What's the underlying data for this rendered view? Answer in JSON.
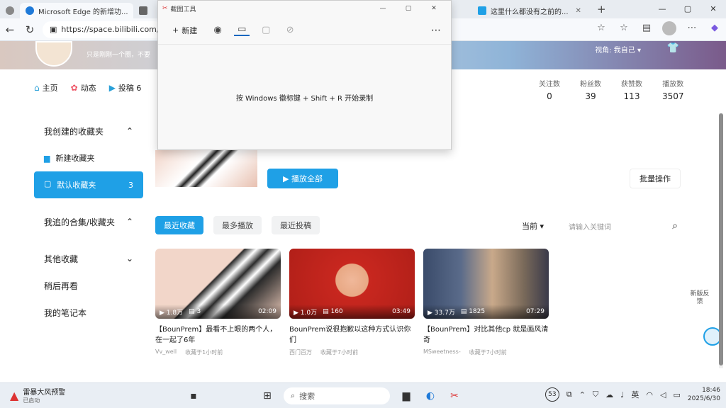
{
  "browser": {
    "tabs": [
      {
        "label": "Microsoft Edge 的新增功..."
      },
      {
        "label": ""
      },
      {
        "label": "这里什么都没有之前的..."
      }
    ],
    "url": "https://space.bilibili.com/3",
    "controls": {
      "minimize": "—",
      "maximize": "▢",
      "close": "✕"
    }
  },
  "banner": {
    "signature": "只是刚刚一个圈，不要",
    "view_label": "视角: 我自己 ▾"
  },
  "profile_nav": [
    {
      "label": "主页",
      "icon": "home-icon"
    },
    {
      "label": "动态",
      "icon": "dynamic-icon"
    },
    {
      "label": "投稿 6",
      "icon": "upload-icon"
    }
  ],
  "stats": [
    {
      "label": "关注数",
      "value": "0"
    },
    {
      "label": "粉丝数",
      "value": "39"
    },
    {
      "label": "获赞数",
      "value": "113"
    },
    {
      "label": "播放数",
      "value": "3507"
    }
  ],
  "sidebar": {
    "created_header": "我创建的收藏夹",
    "new_folder": "新建收藏夹",
    "default_folder": "默认收藏夹",
    "default_count": "3",
    "followed_header": "我追的合集/收藏夹",
    "other": "其他收藏",
    "watch_later": "稍后再看",
    "notes": "我的笔记本"
  },
  "actions": {
    "play_all": "▶ 播放全部",
    "batch": "批量操作"
  },
  "filters": [
    {
      "label": "最近收藏",
      "active": true
    },
    {
      "label": "最多播放",
      "active": false
    },
    {
      "label": "最近投稿",
      "active": false
    }
  ],
  "sort": {
    "label": "当前 ▾"
  },
  "search": {
    "placeholder": "请输入关键词"
  },
  "cards": [
    {
      "views": "▶ 1.8万",
      "comments": "▤ 3",
      "duration": "02:09",
      "title": "【BounPrem】最看不上眼的两个人，在一起了6年",
      "author": "Vv_well",
      "saved": "收藏于1小时前",
      "colors": [
        "#f2d6c9",
        "#2b2b2b"
      ]
    },
    {
      "views": "▶ 1.0万",
      "comments": "▤ 160",
      "duration": "03:49",
      "title": "BounPrem说很抱歉以这种方式认识你们",
      "author": "西门百万",
      "saved": "收藏于7小时前",
      "colors": [
        "#c8271f",
        "#f0b89a"
      ]
    },
    {
      "views": "▶ 33.7万",
      "comments": "▤ 1825",
      "duration": "07:29",
      "title": "【BounPrem】对比其他cp 就是画风清奇",
      "author": "MSweetness-",
      "saved": "收藏于7小时前",
      "colors": [
        "#3a4b6a",
        "#c9a98a"
      ]
    }
  ],
  "side_float": "新版反馈",
  "snipping": {
    "title": "截图工具",
    "new_label": "新建",
    "hint": "按 Windows 徽标键 + Shift + R 开始录制"
  },
  "taskbar": {
    "weather_title": "雷暴大风预警",
    "weather_sub": "已启动",
    "search_label": "搜索",
    "badge": "53",
    "ime": "英",
    "time": "18:46",
    "date": "2025/6/30"
  }
}
